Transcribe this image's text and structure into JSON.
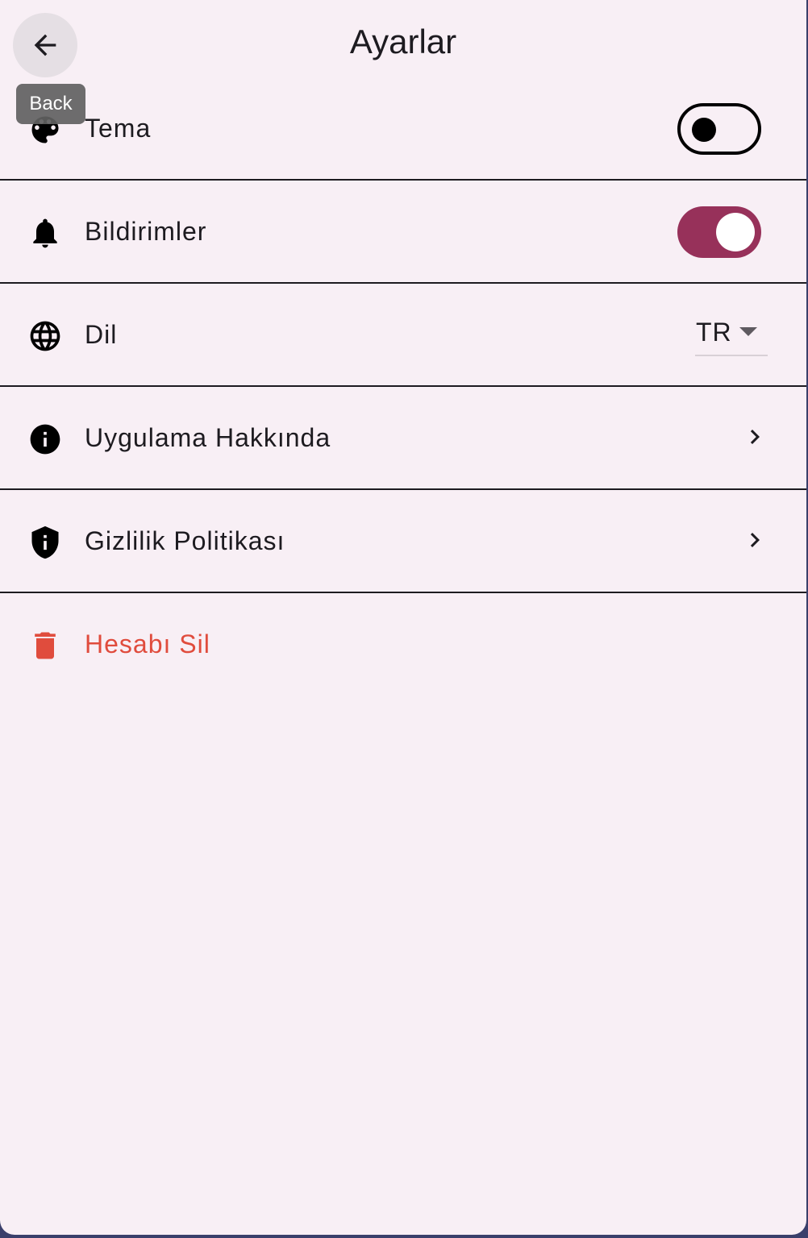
{
  "appbar": {
    "title": "Ayarlar",
    "back_tooltip": "Back"
  },
  "settings": {
    "theme": {
      "label": "Tema",
      "icon": "palette-icon",
      "toggle_on": false
    },
    "notifications": {
      "label": "Bildirimler",
      "icon": "bell-icon",
      "toggle_on": true
    },
    "language": {
      "label": "Dil",
      "icon": "globe-icon",
      "selected": "TR"
    },
    "about": {
      "label": "Uygulama Hakkında",
      "icon": "info-icon"
    },
    "privacy": {
      "label": "Gizlilik Politikası",
      "icon": "shield-info-icon"
    },
    "delete_account": {
      "label": "Hesabı Sil",
      "icon": "trash-icon"
    }
  },
  "colors": {
    "background": "#f8eff5",
    "accent": "#97315a",
    "danger": "#e04c3d",
    "tooltip_bg": "#616161"
  }
}
